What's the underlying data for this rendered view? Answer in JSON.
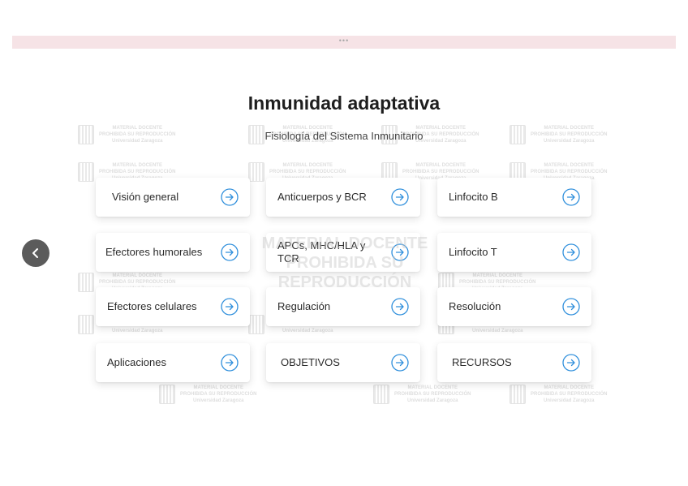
{
  "header_bar": {
    "dots": "•••"
  },
  "page": {
    "title": "Inmunidad adaptativa",
    "subtitle": "Fisiología del Sistema Inmunitario"
  },
  "watermark": {
    "line1": "MATERIAL DOCENTE",
    "line2": "PROHIBIDA SU REPRODUCCIÓN",
    "line3": "Universidad Zaragoza",
    "center_line1": "MATERIAL DOCENTE",
    "center_line2": "PROHIBIDA SU REPRODUCCIÓN"
  },
  "navigation": {
    "back_icon": "chevron-left-icon"
  },
  "cards": [
    {
      "label": "Visión general"
    },
    {
      "label": "Anticuerpos y BCR"
    },
    {
      "label": "Linfocito B"
    },
    {
      "label": "Efectores humorales"
    },
    {
      "label": "APCs, MHC/HLA y TCR"
    },
    {
      "label": "Linfocito T"
    },
    {
      "label": "Efectores celulares"
    },
    {
      "label": "Regulación"
    },
    {
      "label": "Resolución"
    },
    {
      "label": "Aplicaciones"
    },
    {
      "label": "OBJETIVOS"
    },
    {
      "label": "RECURSOS"
    }
  ],
  "colors": {
    "header_bar": "#f6e3e6",
    "accent": "#2f8fdc",
    "back_button": "#5b5b5b",
    "title": "#1e1e1e"
  },
  "icons": {
    "card_arrow": "arrow-right-circle-icon"
  }
}
